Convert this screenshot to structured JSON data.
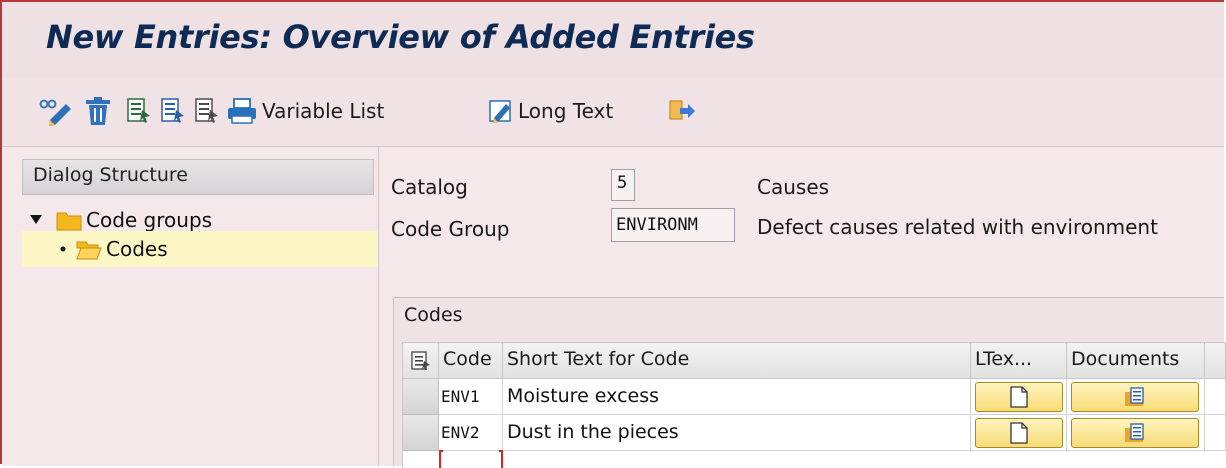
{
  "window": {
    "title": "New Entries: Overview of Added Entries"
  },
  "toolbar": {
    "icons": [
      "display-change-icon",
      "delete-icon",
      "select-all-icon",
      "select-block-icon",
      "deselect-all-icon",
      "print-icon",
      "long-text-icon",
      "exit-icon"
    ],
    "variable_list_label": "Variable List",
    "long_text_label": "Long Text"
  },
  "dialog_structure": {
    "header": "Dialog Structure",
    "items": [
      {
        "label": "Code groups",
        "icon": "folder-icon",
        "expanded": true
      },
      {
        "label": "Codes",
        "icon": "open-folder-icon",
        "selected": true
      }
    ]
  },
  "header_fields": {
    "catalog_label": "Catalog",
    "catalog_value": "5",
    "catalog_text": "Causes",
    "code_group_label": "Code Group",
    "code_group_value": "ENVIRONM",
    "code_group_text": "Defect causes related with environment"
  },
  "codes_table": {
    "title": "Codes",
    "columns": [
      "Code",
      "Short Text for Code",
      "LTex...",
      "Documents"
    ],
    "rows": [
      {
        "code": "ENV1",
        "short_text": "Moisture excess"
      },
      {
        "code": "ENV2",
        "short_text": "Dust in the pieces"
      }
    ]
  },
  "colors": {
    "title_text": "#0e2b56",
    "background": "#f2e4e6",
    "selection": "#fdf7c6",
    "button": "#f7db74",
    "frame_border": "#b33a3a"
  }
}
